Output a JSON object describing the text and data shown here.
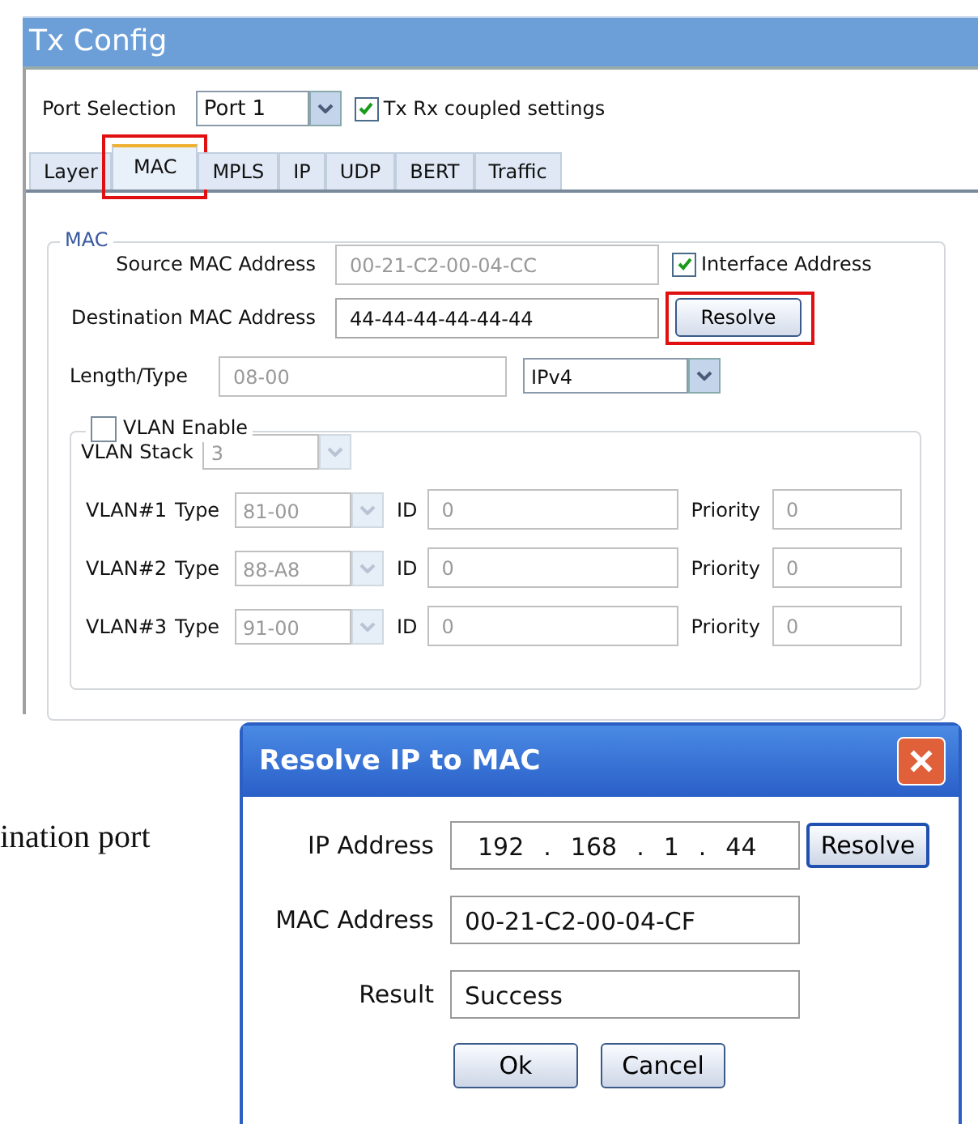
{
  "tx_config": {
    "title": "Tx Config",
    "port_selection": {
      "label": "Port Selection",
      "value": "Port 1"
    },
    "coupled": {
      "label": "Tx Rx coupled settings",
      "checked": true
    },
    "tabs": [
      {
        "label": "Layer",
        "selected": false,
        "highlighted": false
      },
      {
        "label": "MAC",
        "selected": true,
        "highlighted": true
      },
      {
        "label": "MPLS",
        "selected": false,
        "highlighted": false
      },
      {
        "label": "IP",
        "selected": false,
        "highlighted": false
      },
      {
        "label": "UDP",
        "selected": false,
        "highlighted": false
      },
      {
        "label": "BERT",
        "selected": false,
        "highlighted": false
      },
      {
        "label": "Traffic",
        "selected": false,
        "highlighted": false
      }
    ],
    "mac": {
      "legend": "MAC",
      "source": {
        "label": "Source MAC Address",
        "value": "00-21-C2-00-04-CC",
        "disabled": true
      },
      "interface_address": {
        "label": "Interface Address",
        "checked": true
      },
      "destination": {
        "label": "Destination MAC Address",
        "value": "44-44-44-44-44-44",
        "disabled": false
      },
      "resolve_button": {
        "label": "Resolve",
        "highlighted": true
      },
      "length_type": {
        "label": "Length/Type",
        "value": "08-00",
        "disabled": true
      },
      "protocol": {
        "value": "IPv4"
      }
    },
    "vlan": {
      "enable": {
        "label": "VLAN Enable",
        "checked": false
      },
      "stack": {
        "label": "VLAN Stack",
        "value": "3"
      },
      "rows": [
        {
          "name": "VLAN#1",
          "type_label": "Type",
          "type": "81-00",
          "id_label": "ID",
          "id": "0",
          "priority_label": "Priority",
          "priority": "0"
        },
        {
          "name": "VLAN#2",
          "type_label": "Type",
          "type": "88-A8",
          "id_label": "ID",
          "id": "0",
          "priority_label": "Priority",
          "priority": "0"
        },
        {
          "name": "VLAN#3",
          "type_label": "Type",
          "type": "91-00",
          "id_label": "ID",
          "id": "0",
          "priority_label": "Priority",
          "priority": "0"
        }
      ]
    }
  },
  "page_text": "ination port",
  "dialog": {
    "title": "Resolve IP to MAC",
    "ip_address": {
      "label": "IP Address",
      "octets": [
        "192",
        "168",
        "1",
        "44"
      ],
      "separator": "."
    },
    "resolve_button": {
      "label": "Resolve"
    },
    "mac_address": {
      "label": "MAC Address",
      "value": "00-21-C2-00-04-CF"
    },
    "result": {
      "label": "Result",
      "value": "Success"
    },
    "buttons": [
      "Ok",
      "Cancel"
    ]
  }
}
